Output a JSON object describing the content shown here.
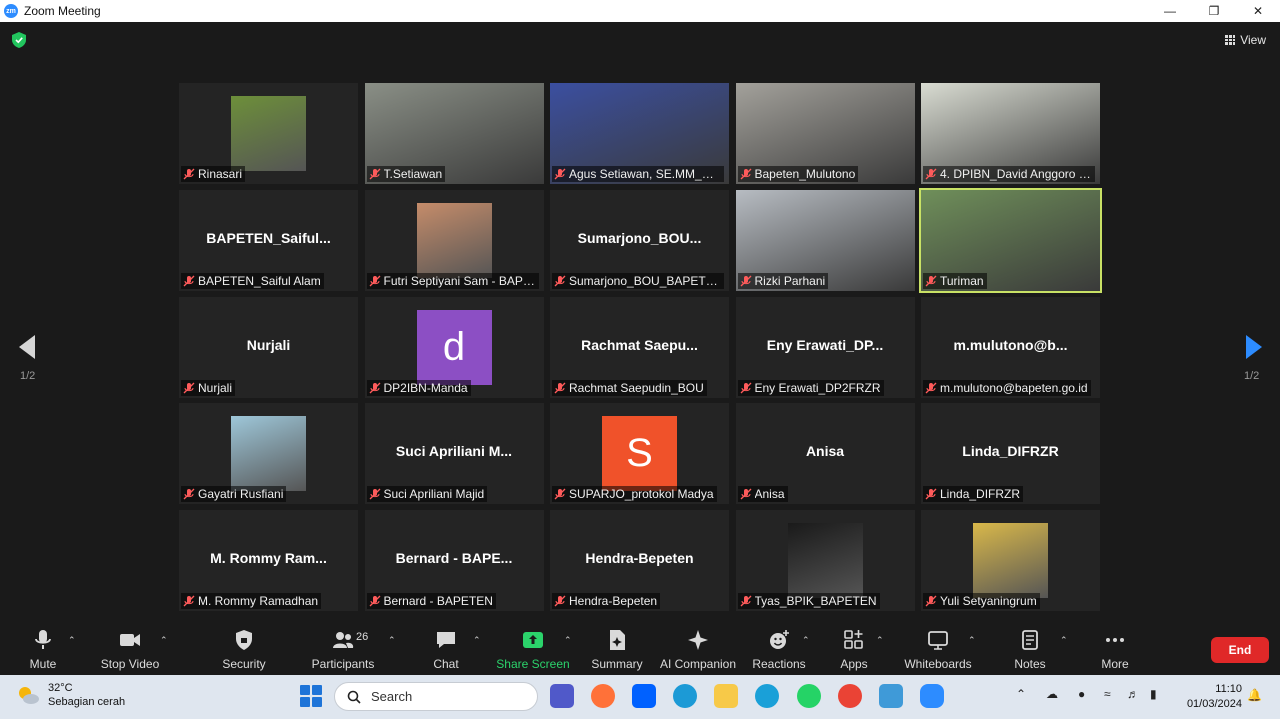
{
  "window": {
    "title": "Zoom Meeting",
    "app_icon_text": "zm"
  },
  "meeting": {
    "view_label": "View",
    "page_indicator_left": "1/2",
    "page_indicator_right": "1/2",
    "tiles": [
      {
        "name": "Rinasari",
        "display": "photo",
        "color": "#6d8f3a"
      },
      {
        "name": "T.Setiawan",
        "display": "video",
        "color": "#8a8f86"
      },
      {
        "name": "Agus Setiawan, SE.MM_Bapeten",
        "display": "video",
        "color": "#3b4fa0"
      },
      {
        "name": "Bapeten_Mulutono",
        "display": "video",
        "color": "#a3a19b"
      },
      {
        "name": "4. DPIBN_David Anggoro P...",
        "display": "video",
        "color": "#d9dcd2"
      },
      {
        "name": "BAPETEN_Saiful Alam",
        "display": "text",
        "big": "BAPETEN_Saiful..."
      },
      {
        "name": "Futri Septiyani Sam - BAPE...",
        "display": "photo",
        "color": "#c58c6a"
      },
      {
        "name": "Sumarjono_BOU_BAPETEN",
        "display": "text",
        "big": "Sumarjono_BOU..."
      },
      {
        "name": "Rizki Parhani",
        "display": "video",
        "color": "#b7bcc2"
      },
      {
        "name": "Turiman",
        "display": "video",
        "color": "#6f8f5a",
        "active": true
      },
      {
        "name": "Nurjali",
        "display": "text",
        "big": "Nurjali"
      },
      {
        "name": "DP2IBN-Manda",
        "display": "letter",
        "letter": "d",
        "color": "#8c4fc4"
      },
      {
        "name": "Rachmat Saepudin_BOU",
        "display": "text",
        "big": "Rachmat  Saepu..."
      },
      {
        "name": "Eny Erawati_DP2FRZR",
        "display": "text",
        "big": "Eny  Erawati_DP..."
      },
      {
        "name": "m.mulutono@bapeten.go.id",
        "display": "text",
        "big": "m.mulutono@b..."
      },
      {
        "name": "Gayatri Rusfiani",
        "display": "photo",
        "color": "#9ec7d9"
      },
      {
        "name": "Suci Apriliani Majid",
        "display": "text",
        "big": "Suci  Apriliani  M..."
      },
      {
        "name": "SUPARJO_protokol Madya",
        "display": "letter",
        "letter": "S",
        "color": "#f0522a"
      },
      {
        "name": "Anisa",
        "display": "text",
        "big": "Anisa"
      },
      {
        "name": "Linda_DIFRZR",
        "display": "text",
        "big": "Linda_DIFRZR"
      },
      {
        "name": "M. Rommy Ramadhan",
        "display": "text",
        "big": "M.  Rommy  Ram..."
      },
      {
        "name": "Bernard - BAPETEN",
        "display": "text",
        "big": "Bernard  -  BAPE..."
      },
      {
        "name": "Hendra-Bepeten",
        "display": "text",
        "big": "Hendra-Bepeten"
      },
      {
        "name": "Tyas_BPIK_BAPETEN",
        "display": "photo",
        "color": "#1a1a1a"
      },
      {
        "name": "Yuli Setyaningrum",
        "display": "photo",
        "color": "#d9b84a"
      }
    ]
  },
  "toolbar": {
    "mute": "Mute",
    "stop_video": "Stop Video",
    "security": "Security",
    "participants": "Participants",
    "participants_count": "26",
    "chat": "Chat",
    "share_screen": "Share Screen",
    "summary": "Summary",
    "ai_companion": "AI Companion",
    "reactions": "Reactions",
    "apps": "Apps",
    "whiteboards": "Whiteboards",
    "notes": "Notes",
    "more": "More",
    "end": "End"
  },
  "taskbar": {
    "temperature": "32°C",
    "weather": "Sebagian cerah",
    "search_placeholder": "Search",
    "time": "11:10",
    "date": "01/03/2024"
  }
}
